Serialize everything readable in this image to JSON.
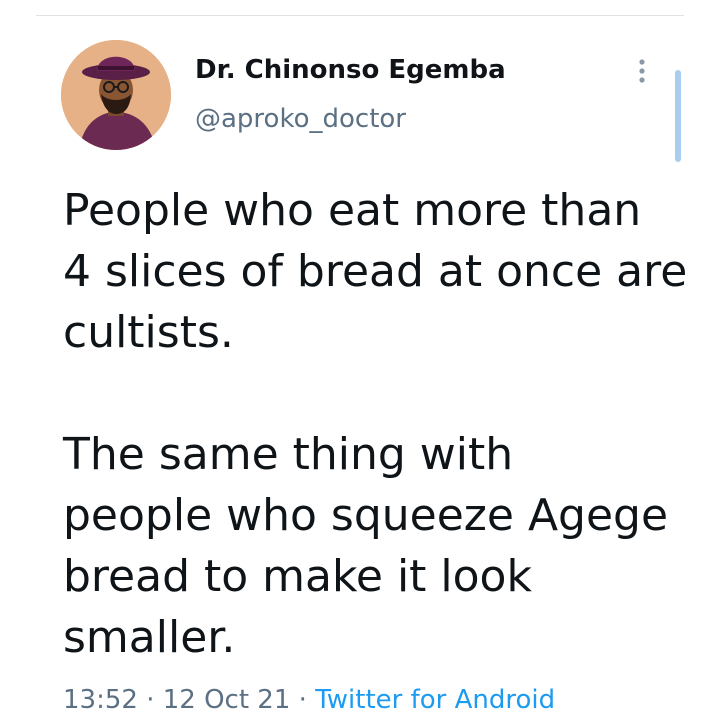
{
  "author": {
    "display_name": "Dr. Chinonso Egemba",
    "handle": "@aproko_doctor",
    "avatar_icon": "profile-photo"
  },
  "more_options_icon": "more-vertical-icon",
  "tweet": {
    "paragraph_1": [
      "People who eat more than",
      "4 slices of bread at once are",
      "cultists."
    ],
    "paragraph_2": [
      "The same thing with",
      "people who squeeze Agege",
      "bread to make it look",
      "smaller."
    ]
  },
  "meta": {
    "time": "13:52",
    "separator": " · ",
    "date": "12 Oct 21",
    "source": "Twitter for Android"
  },
  "colors": {
    "link": "#1d9bf0",
    "secondary_text": "#5b7083",
    "scrollbar": "#a9cdee"
  }
}
